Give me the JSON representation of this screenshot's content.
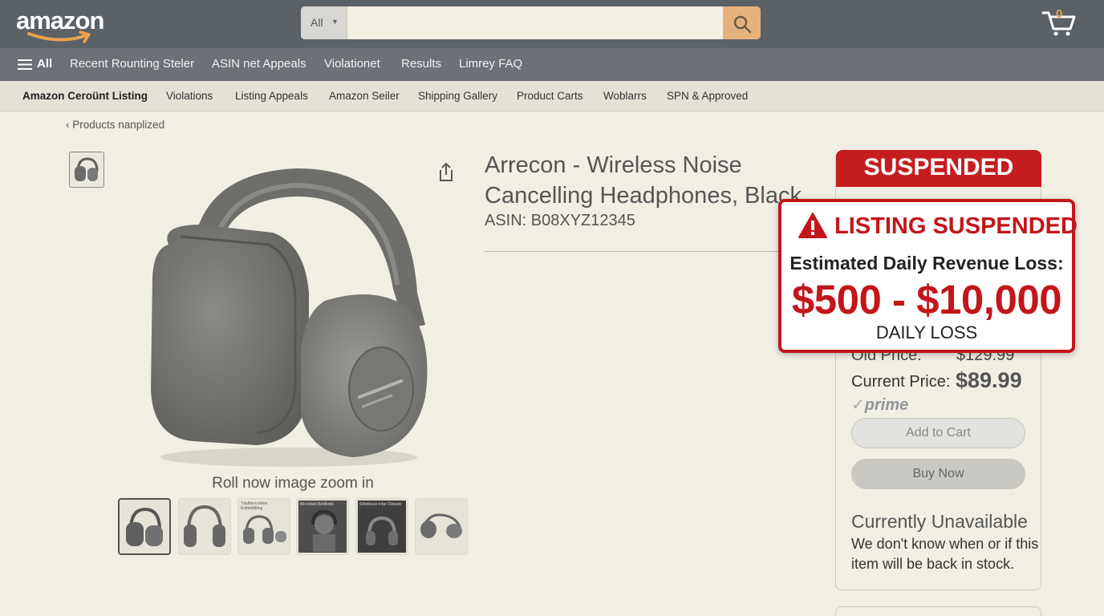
{
  "header": {
    "logo": "amazon",
    "search": {
      "category": "All",
      "placeholder": "",
      "value": ""
    },
    "cart_count": "0"
  },
  "nav": {
    "all_label": "All",
    "links": [
      "Recent Rounting Steler",
      "ASIN net Appeals",
      "Violationet",
      "Results",
      "Limrey FAQ"
    ]
  },
  "subnav": {
    "items": [
      "Amazon Ceroünt Listing",
      "Violations",
      "Listing Appeals",
      "Amazon Seiler",
      "Shipping Gallery",
      "Product Carts",
      "Woblarrs",
      "SPN & Approved"
    ]
  },
  "breadcrumb": "Products nanplized",
  "gallery": {
    "zoom_caption": "Roll now image zoom in",
    "thumb_captions": [
      "",
      "",
      "Tdulbera Initee Exttntdlitting",
      "Mcnntted Bettlbrde",
      "Srtielbeee Inter Fleteatt",
      ""
    ]
  },
  "product": {
    "title": "Arrecon - Wireless Noise Cancelling Headphones, Black",
    "asin": "ASIN: B08XYZ12345"
  },
  "buybox": {
    "status_banner": "SUSPENDED",
    "old_price_label": "Old Price:",
    "old_price": "$129.99",
    "current_price_label": "Current Price:",
    "current_price": "$89.99",
    "prime": "prime",
    "add_to_cart": "Add to Cart",
    "buy_now": "Buy Now",
    "availability_title": "Currently Unavailable",
    "availability_text": "We don't know when or if this item will be back in stock."
  },
  "alert": {
    "heading": "LISTING SUSPENDED",
    "subheading": "Estimated Daily Revenue Loss:",
    "amount": "$500 - $10,000",
    "footer": "DAILY LOSS"
  },
  "colors": {
    "header_bg": "#5a6167",
    "nav_bg": "#6b7177",
    "alert_red": "#c3161b",
    "search_button": "#e5b27d",
    "page_bg": "#f1eee4"
  }
}
